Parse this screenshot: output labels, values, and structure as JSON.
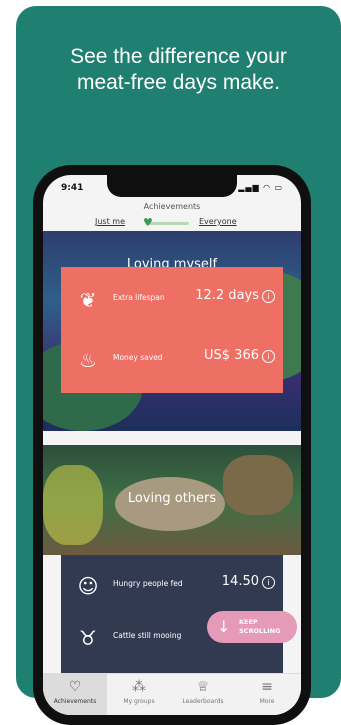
{
  "headline": {
    "line1": "See the difference your",
    "line2": "meat-free days make."
  },
  "status_bar": {
    "time": "9:41"
  },
  "screen": {
    "title": "Achievements",
    "toggle": {
      "left_label": "Just me",
      "right_label": "Everyone"
    }
  },
  "self_section": {
    "title": "Loving myself",
    "stats": [
      {
        "label": "Extra lifespan",
        "value": "12.2 days",
        "icon": "heart-tree-icon"
      },
      {
        "label": "Money saved",
        "value": "US$ 366",
        "icon": "piggy-bank-icon"
      }
    ]
  },
  "others_section": {
    "title": "Loving others",
    "stats": [
      {
        "label": "Hungry people fed",
        "value": "14.50",
        "icon": "family-icon"
      },
      {
        "label": "Cattle still mooing",
        "value": "",
        "icon": "cow-icon"
      }
    ]
  },
  "fab": {
    "line1": "KEEP",
    "line2": "SCROLLING"
  },
  "tabs": [
    {
      "label": "Achievements",
      "icon": "heart-icon",
      "active": true
    },
    {
      "label": "My groups",
      "icon": "groups-icon",
      "active": false
    },
    {
      "label": "Leaderboards",
      "icon": "trophy-icon",
      "active": false
    },
    {
      "label": "More",
      "icon": "menu-icon",
      "active": false
    }
  ],
  "colors": {
    "background_green": "#1f7f70",
    "coral_panel": "#ee6f64",
    "navy_panel": "#323a52",
    "fab_pink": "#e59ab8",
    "toggle_green": "#3c9a58"
  }
}
